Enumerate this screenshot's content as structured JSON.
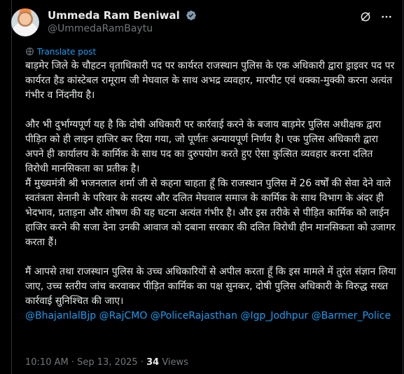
{
  "author": {
    "name": "Ummeda Ram Beniwal",
    "handle": "@UmmedaRamBaytu"
  },
  "post": {
    "translate_label": "Translate post",
    "paragraphs": [
      "बाड़मेर जिले के चौहटन वृताधिकारी पद पर कार्यरत राजस्थान पुलिस के एक अधिकारी द्वारा ड्राइवर पद पर कार्यरत हैड कांस्टेबल रामूराम जी मेघवाल के साथ अभद्र व्यवहार, मारपीट एवं धक्का-मुक्की करना अत्यंत गंभीर व निंदनीय है।",
      "और भी दुर्भाग्यपूर्ण यह है कि दोषी अधिकारी पर कार्रवाई करने के बजाय बाड़मेर पुलिस अधीक्षक द्वारा पीड़ित को ही लाइन हाजिर कर दिया गया, जो पूर्णतः अन्यायपूर्ण निर्णय है। एक पुलिस अधिकारी द्वारा अपने ही कार्यालय के कार्मिक के साथ पद का दुरुपयोग करते हुए ऐसा कुत्सित व्यवहार करना दलित विरोधी मानसिकता का प्रतीक है।",
      "मैं मुख्यमंत्री श्री भजनलाल शर्मा जी से कहना चाहता हूँ कि राजस्थान पुलिस में 26 वर्षों की सेवा देने वाले स्वतंत्रता सेनानी के परिवार के सदस्य और दलित मेघवाल समाज के कार्मिक के साथ विभाग के अंदर ही भेदभाव, प्रताड़ना और शोषण की यह घटना अत्यंत गंभीर है। और इस तरीके से पीड़ित कार्मिक को लाईन हाजिर करने की सजा देना उनकी आवाज को दबाना सरकार की दलित विरोधी हीन मानसिकता को उजागर करता हैं।",
      "मैं आपसे तथा राजस्थान पुलिस के उच्च अधिकारियों से अपील करता हूँ कि इस मामले में तुरंत संज्ञान लिया जाए, उच्च स्तरीय जांच करवाकर पीड़ित कार्मिक का पक्ष सुनकर, दोषी पुलिस अधिकारी के विरुद्ध सख्त कार्रवाई सुनिश्चित की जाए।"
    ],
    "mentions": [
      "@BhajanlalBjp",
      "@RajCMO",
      "@PoliceRajasthan",
      "@Igp_Jodhpur",
      "@Barmer_Police"
    ]
  },
  "meta": {
    "time": "10:10 AM",
    "separator": "·",
    "date": "Sep 13, 2025",
    "views_count": "34",
    "views_label": "Views"
  },
  "colors": {
    "background": "#000000",
    "text": "#e7e9ea",
    "secondary": "#71767b",
    "accent": "#1d9bf0"
  }
}
